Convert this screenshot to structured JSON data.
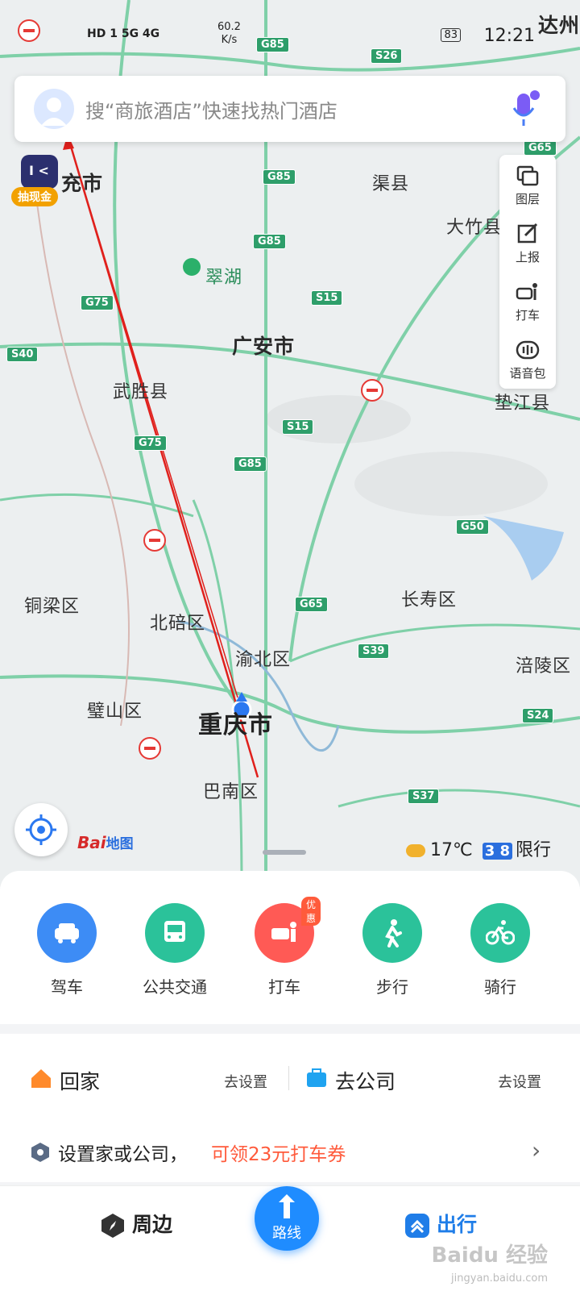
{
  "status_bar": {
    "time": "12:21",
    "network_left": "HD 1  5G  4G",
    "speed_value": "60.2",
    "speed_unit": "K/s",
    "battery": "83"
  },
  "search": {
    "placeholder": "搜“商旅酒店”快速找热门酒店"
  },
  "side_tools": [
    {
      "label": "图层",
      "icon": "layers-icon"
    },
    {
      "label": "上报",
      "icon": "report-edit-icon"
    },
    {
      "label": "打车",
      "icon": "taxi-icon"
    },
    {
      "label": "语音包",
      "icon": "voice-pack-icon"
    }
  ],
  "promo": {
    "cash_label": "抽现金"
  },
  "map": {
    "places": {
      "nanchong": "充市",
      "qu_county": "渠县",
      "dazhu": "大竹县",
      "cuihu": "翠湖",
      "guangan": "广安市",
      "wusheng": "武胜县",
      "dianjiang": "垫江县",
      "tongliang": "铜梁区",
      "beibei": "北碚区",
      "yubei": "渝北区",
      "changshou": "长寿区",
      "fuling": "涪陵区",
      "bishan": "璧山区",
      "chongqing": "重庆市",
      "banan": "巴南区",
      "dazhou": "达州"
    },
    "shields": [
      "G85",
      "S26",
      "G65",
      "G85",
      "G85",
      "S15",
      "G75",
      "S40",
      "S15",
      "G75",
      "G85",
      "G50",
      "G65",
      "S39",
      "S24",
      "S37"
    ],
    "logo_text": "Bai",
    "logo_suffix": "地图",
    "weather": {
      "temp": "17℃",
      "limit_numbers": "3 8",
      "limit_label": "限行"
    }
  },
  "modes": [
    {
      "label": "驾车",
      "color": "#3d8cf5",
      "icon": "car-icon"
    },
    {
      "label": "公共交通",
      "color": "#2bc29a",
      "icon": "bus-icon"
    },
    {
      "label": "打车",
      "color": "#ff5a55",
      "icon": "taxi-icon",
      "badge": "优惠"
    },
    {
      "label": "步行",
      "color": "#2bc29a",
      "icon": "walk-icon"
    },
    {
      "label": "骑行",
      "color": "#2bc29a",
      "icon": "bike-icon"
    }
  ],
  "shortcuts": {
    "home_label": "回家",
    "home_action": "去设置",
    "work_label": "去公司",
    "work_action": "去设置",
    "hint_prefix": "设置家或公司，",
    "hint_highlight": "可领23元打车券",
    "hint_arrow": "›"
  },
  "tabbar": {
    "nearby": "周边",
    "route": "路线",
    "travel": "出行"
  },
  "watermark": {
    "main": "Baidu 经验",
    "sub": "jingyan.baidu.com"
  }
}
